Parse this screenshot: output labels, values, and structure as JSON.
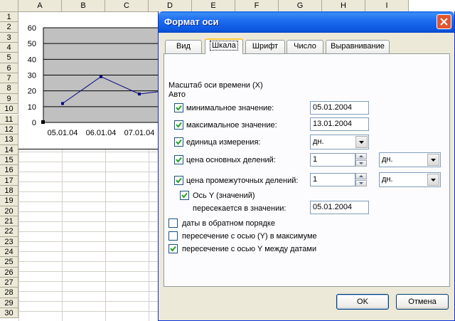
{
  "spreadsheet": {
    "columns": [
      "A",
      "B",
      "C",
      "D",
      "E",
      "F",
      "G",
      "H",
      "I"
    ],
    "rows": [
      "1",
      "2",
      "3",
      "4",
      "5",
      "6",
      "7",
      "8",
      "9",
      "10",
      "11",
      "12",
      "13",
      "14",
      "15",
      "16",
      "17",
      "18",
      "19",
      "20",
      "21",
      "22",
      "23",
      "24",
      "25",
      "26",
      "27",
      "28",
      "29",
      "30"
    ]
  },
  "chart_data": {
    "type": "line",
    "categories": [
      "05.01.04",
      "06.01.04",
      "07.01.04"
    ],
    "values": [
      12,
      29,
      18,
      21
    ],
    "ylim": [
      0,
      60
    ],
    "yticks": [
      "60",
      "50",
      "40",
      "30",
      "20",
      "10",
      "0"
    ],
    "grid": true,
    "plot_bg": "#c0c0c0",
    "line_color": "#000080"
  },
  "dialog": {
    "title": "Формат оси",
    "close_icon": "close-icon",
    "tabs": [
      {
        "label": "Вид",
        "active": false
      },
      {
        "label": "Шкала",
        "active": true
      },
      {
        "label": "Шрифт",
        "active": false
      },
      {
        "label": "Число",
        "active": false
      },
      {
        "label": "Выравнивание",
        "active": false
      }
    ],
    "scale": {
      "heading": "Масштаб оси времени (X)",
      "auto": "Авто",
      "min_label": "минимальное значение:",
      "min_checked": true,
      "min_value": "05.01.2004",
      "max_label": "максимальное значение:",
      "max_checked": true,
      "max_value": "13.01.2004",
      "unit_label": "единица измерения:",
      "unit_checked": true,
      "unit_value": "дн.",
      "major_label": "цена основных делений:",
      "major_checked": true,
      "major_value": "1",
      "major_unit": "дн.",
      "minor_label": "цена промежуточных делений:",
      "minor_checked": true,
      "minor_value": "1",
      "minor_unit": "дн.",
      "yaxis_label": "Ось Y (значений)",
      "yaxis_checked": true,
      "cross_label": "пересекается в значении:",
      "cross_value": "05.01.2004",
      "reverse_label": "даты в обратном порядке",
      "reverse_checked": false,
      "cross_max_label": "пересечение с осью (Y) в максимуме",
      "cross_max_checked": false,
      "between_label": "пересечение с осью Y между датами",
      "between_checked": true
    },
    "ok_label": "OK",
    "cancel_label": "Отмена"
  }
}
